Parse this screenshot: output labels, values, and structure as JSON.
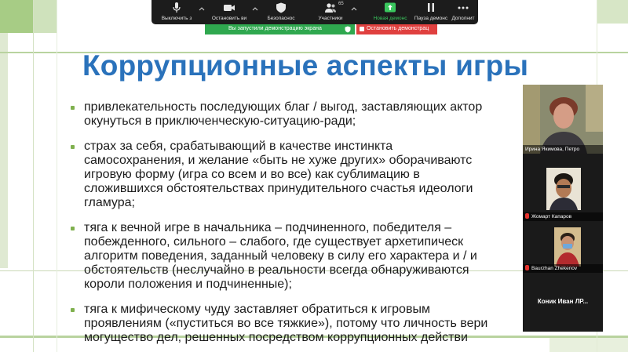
{
  "slide": {
    "title": "Коррупционные аспекты игры",
    "bullets": [
      [
        "привлекательность последующих благ / выгод, заставляющих актор",
        "окунуться в приключенческую-ситуацию-ради;"
      ],
      [
        "страх за себя, срабатывающий в качестве инстинкта",
        "самосохранения, и желание «быть не хуже других» оборачиваютс",
        "игровую форму (игра со всем и во все) как сублимацию в",
        "сложившихся обстоятельствах принудительного счастья идеологи",
        "гламура;"
      ],
      [
        "тяга к вечной игре в начальника – подчиненного, победителя –",
        "побежденного, сильного – слабого, где существует архетипическ",
        "алгоритм поведения, заданный человеку в силу его характера и / и",
        "обстоятельств (неслучайно в реальности всегда обнаруживаются",
        "короли положения и подчиненные);"
      ],
      [
        "тяга к мифическому чуду заставляет обратиться к игровым",
        "проявлениям («пуститься во все тяжкие»), потому что личность вери",
        "могущество дел, решенных посредством коррупционных действи"
      ]
    ],
    "accent_color": "#2a72bb",
    "bullet_color": "#7fb04e"
  },
  "toolbar": {
    "items": [
      {
        "label": "Выключить з",
        "icon": "microphone-icon"
      },
      {
        "label": "Остановить ви",
        "icon": "video-camera-icon"
      },
      {
        "label": "Безопаснос",
        "icon": "shield-icon"
      },
      {
        "label": "Участники",
        "icon": "participants-icon"
      },
      {
        "label": "Новая демонс",
        "icon": "share-screen-icon"
      },
      {
        "label": "Пауза демонс",
        "icon": "pause-icon"
      },
      {
        "label": "Дополнит",
        "icon": "more-icon"
      }
    ],
    "participant_count": "65",
    "active_color": "#3ac75e"
  },
  "share_banner": {
    "status": "Вы запустили демонстрацию экрана",
    "stop_label": "Остановить демонстрац",
    "status_color": "#2fa84f",
    "stop_color": "#e0403f"
  },
  "gallery": {
    "participants": [
      {
        "name": "Ирина Якимова, Петро",
        "muted": false
      },
      {
        "name": "Жомарт Капаров",
        "muted": true
      },
      {
        "name": "Baurzhan Zhekenov",
        "muted": true
      },
      {
        "name": "Коник Иван ЛР...",
        "muted": false
      }
    ]
  }
}
